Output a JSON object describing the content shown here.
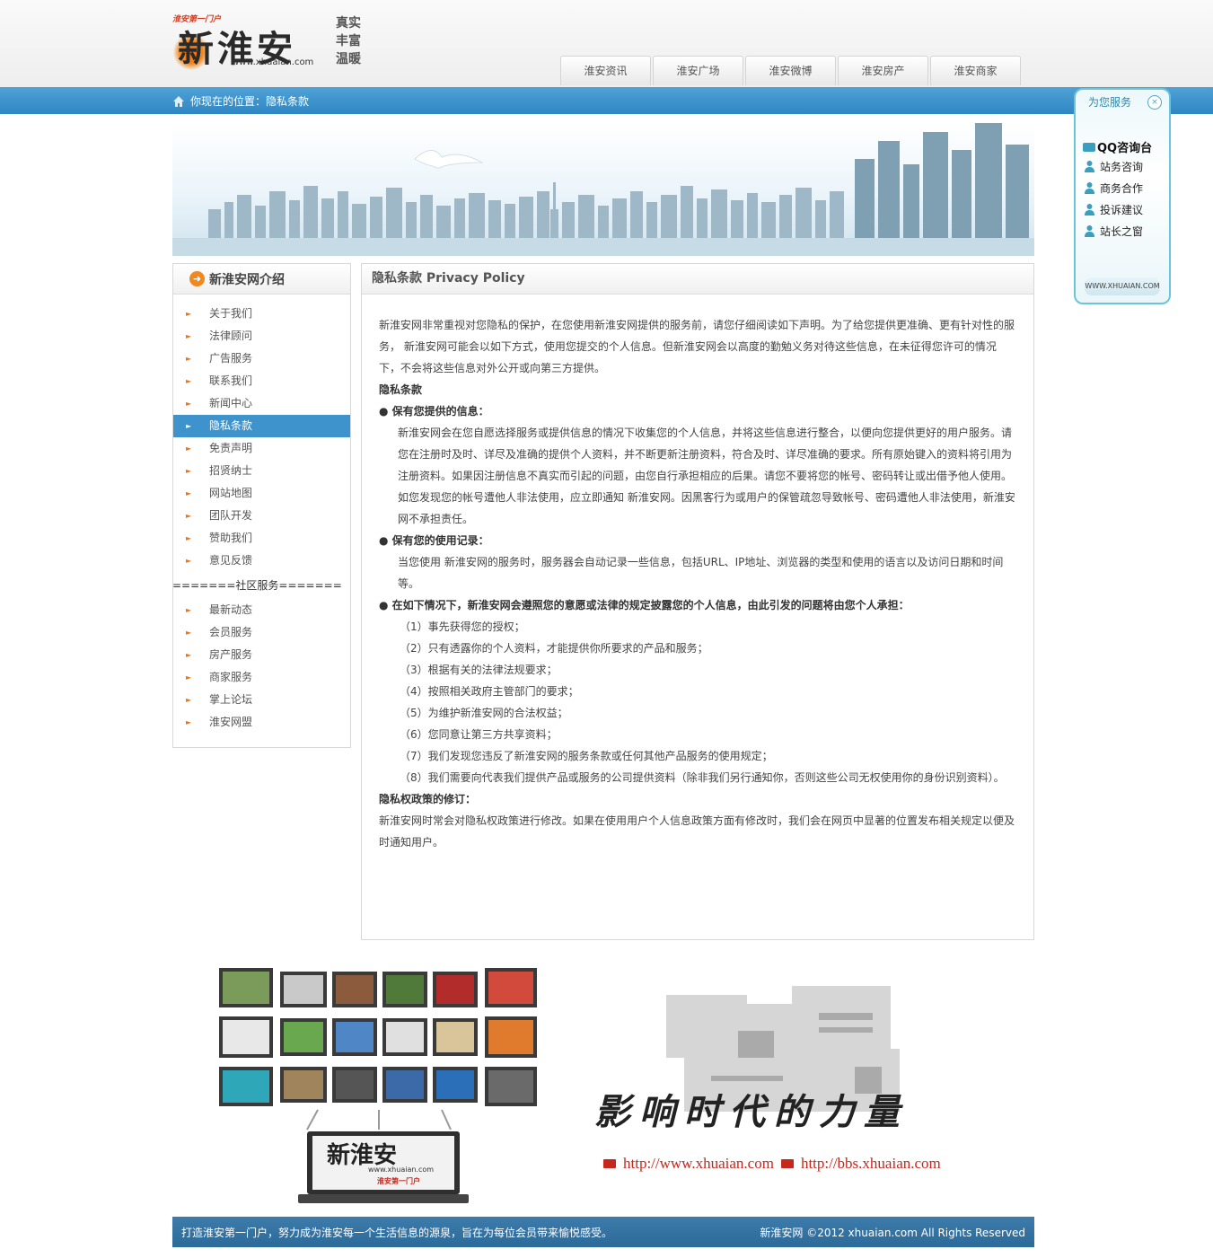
{
  "header": {
    "logo_tag": "淮安第一门户",
    "logo_text": "新淮安",
    "logo_url": "www.xhuaian.com",
    "slogan": "真实 丰富 温暖",
    "nav": [
      "淮安资讯",
      "淮安广场",
      "淮安微博",
      "淮安房产",
      "淮安商家"
    ]
  },
  "breadcrumb": {
    "text": "你现在的位置：隐私条款"
  },
  "sidebar": {
    "title": "新淮安网介绍",
    "items": [
      "关于我们",
      "法律顾问",
      "广告服务",
      "联系我们",
      "新闻中心",
      "隐私条款",
      "免责声明",
      "招贤纳士",
      "网站地图",
      "团队开发",
      "赞助我们",
      "意见反馈"
    ],
    "active_index": 5,
    "divider": "=======社区服务=======",
    "community_items": [
      "最新动态",
      "会员服务",
      "房产服务",
      "商家服务",
      "掌上论坛",
      "淮安网盟"
    ]
  },
  "main": {
    "title": "隐私条款 Privacy Policy",
    "intro": "新淮安网非常重视对您隐私的保护，在您使用新淮安网提供的服务前，请您仔细阅读如下声明。为了给您提供更准确、更有针对性的服务，  新淮安网可能会以如下方式，使用您提交的个人信息。但新淮安网会以高度的勤勉义务对待这些信息，在未征得您许可的情况下，不会将这些信息对外公开或向第三方提供。",
    "section_title": "隐私条款",
    "b1_title": "● 保有您提供的信息：",
    "b1_text": "新淮安网会在您自愿选择服务或提供信息的情况下收集您的个人信息，并将这些信息进行整合，以便向您提供更好的用户服务。请您在注册时及时、详尽及准确的提供个人资料，并不断更新注册资料，符合及时、详尽准确的要求。所有原始键入的资料将引用为注册资料。如果因注册信息不真实而引起的问题，由您自行承担相应的后果。请您不要将您的帐号、密码转让或出借予他人使用。如您发现您的帐号遭他人非法使用，应立即通知 新淮安网。因黑客行为或用户的保管疏忽导致帐号、密码遭他人非法使用，新淮安网不承担责任。",
    "b2_title": "● 保有您的使用记录：",
    "b2_text": "当您使用 新淮安网的服务时，服务器会自动记录一些信息，包括URL、IP地址、浏览器的类型和使用的语言以及访问日期和时间等。",
    "b3_title": "● 在如下情况下，新淮安网会遵照您的意愿或法律的规定披露您的个人信息，由此引发的问题将由您个人承担：",
    "b3_items": [
      "（1）事先获得您的授权；",
      "（2）只有透露你的个人资料，才能提供你所要求的产品和服务；",
      "（3）根据有关的法律法规要求；",
      "（4）按照相关政府主管部门的要求；",
      "（5）为维护新淮安网的合法权益；",
      "（6）您同意让第三方共享资料；",
      "（7）我们发现您违反了新淮安网的服务条款或任何其他产品服务的使用规定；",
      "（8）我们需要向代表我们提供产品或服务的公司提供资料（除非我们另行通知你，否则这些公司无权使用你的身份识别资料）。"
    ],
    "rev_title": "隐私权政策的修订：",
    "rev_text": "新淮安网时常会对隐私权政策进行修改。如果在使用用户个人信息政策方面有修改时，我们会在网页中显著的位置发布相关规定以便及时通知用户。"
  },
  "float_panel": {
    "title": "为您服务",
    "close": "×",
    "qq_label": "QQ咨询台",
    "items": [
      "站务咨询",
      "商务合作",
      "投诉建议",
      "站长之窗"
    ],
    "footer": "WWW.XHUAIAN.COM"
  },
  "bottom_banner": {
    "slogan": "影响时代的力量",
    "url1": "http://www.xhuaian.com",
    "url2": "http://bbs.xhuaian.com",
    "laptop_logo": "新淮安",
    "laptop_url": "www.xhuaian.com",
    "laptop_tag": "淮安第一门户"
  },
  "footer": {
    "left": "打造淮安第一门户，努力成为淮安每一个生活信息的源泉，旨在为每位会员带来愉悦感受。",
    "right": "新淮安网 ©2012 xhuaian.com All Rights Reserved"
  },
  "colors": {
    "accent_blue": "#2f86c2",
    "orange": "#f0871f",
    "footer_blue": "#2c6a9a",
    "url_red": "#c6271d"
  }
}
